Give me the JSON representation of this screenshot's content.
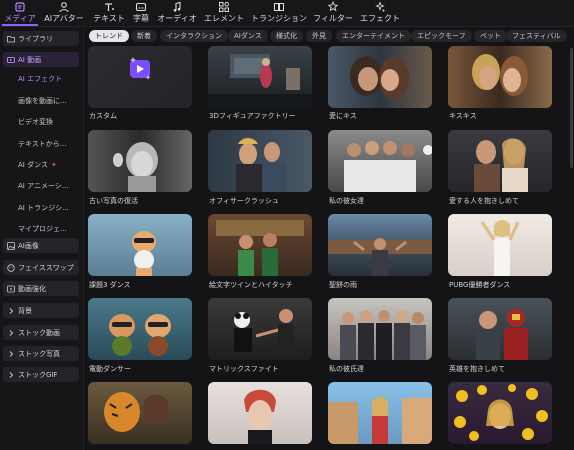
{
  "toolbar": {
    "tabs": [
      {
        "label": "メディア",
        "icon": "media-icon"
      },
      {
        "label": "AIアバター",
        "icon": "avatar-icon"
      },
      {
        "label": "テキスト",
        "icon": "text-icon"
      },
      {
        "label": "字幕",
        "icon": "subtitle-icon"
      },
      {
        "label": "オーディオ",
        "icon": "audio-icon"
      },
      {
        "label": "エレメント",
        "icon": "element-icon"
      },
      {
        "label": "トランジション",
        "icon": "transition-icon"
      },
      {
        "label": "フィルター",
        "icon": "filter-icon"
      },
      {
        "label": "エフェクト",
        "icon": "effect-icon"
      }
    ],
    "active_color": "#8f62ff"
  },
  "sidebar": {
    "library": "ライブラリ",
    "ai_video": "AI 動画",
    "sub": [
      "AI エフェクト",
      "画像を動画に...",
      "ビデオ変換",
      "テキストから...",
      "AI ダンス",
      "AI アニメーシ...",
      "AI トランジシ...",
      "マイプロジェ..."
    ],
    "sections": [
      "AI画像",
      "フェイススワップ",
      "動画強化",
      "背景",
      "ストック動画",
      "ストック写真",
      "ストックGIF"
    ]
  },
  "chips": [
    "トレンド",
    "新着",
    "インタラクション",
    "AIダンス",
    "様式化",
    "外見",
    "エンターテイメント",
    "エピックモーフ",
    "ペット",
    "フェスティバル"
  ],
  "cards": [
    {
      "caption": "カスタム"
    },
    {
      "caption": "3Dフィギュアファクトリー"
    },
    {
      "caption": "愛にキス"
    },
    {
      "caption": "キスキス"
    },
    {
      "caption": "古い写真の復活"
    },
    {
      "caption": "オフィサークラッシュ"
    },
    {
      "caption": "私の彼女達"
    },
    {
      "caption": "愛する人を抱きしめて"
    },
    {
      "caption": "課題3 ダンス"
    },
    {
      "caption": "絵文字ツインとハイタッチ"
    },
    {
      "caption": "聖餅の雨"
    },
    {
      "caption": "PUBG優勝者ダンス"
    },
    {
      "caption": "電動ダンサー"
    },
    {
      "caption": "マトリックスファイト"
    },
    {
      "caption": "私の彼氏達"
    },
    {
      "caption": "英雄を抱きしめて"
    },
    {
      "caption": ""
    },
    {
      "caption": ""
    },
    {
      "caption": ""
    },
    {
      "caption": ""
    }
  ]
}
